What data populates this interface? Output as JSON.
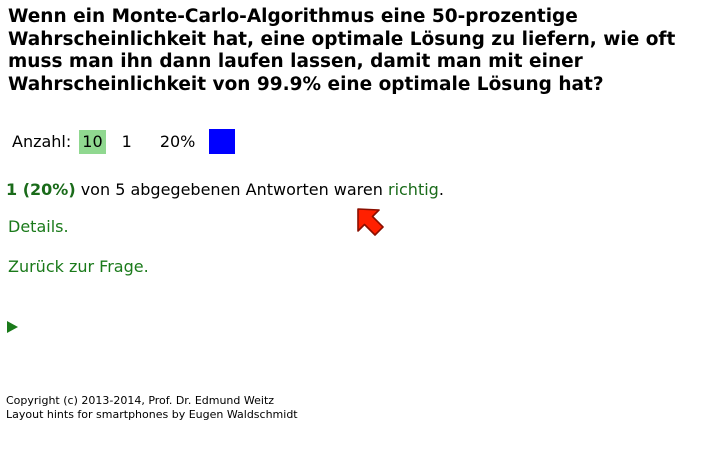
{
  "question": {
    "text": "Wenn ein Monte-Carlo-Algorithmus eine 50-prozentige Wahrscheinlichkeit hat, eine optimale Lösung zu liefern, wie oft muss man ihn dann laufen lassen, damit man mit einer Wahrscheinlichkeit von 99.9% eine optimale Lösung hat?"
  },
  "answers": [
    {
      "label": "Anzahl:",
      "value": "10",
      "count": "1",
      "percent_text": "20%",
      "percent": 20,
      "bar_color": "#0000ff",
      "highlight_color": "#90d890"
    }
  ],
  "summary": {
    "correct_count": "1 (20%)",
    "middle_text": " von 5 abgegebenen Antworten waren ",
    "correct_word": "richtig",
    "end": "."
  },
  "links": {
    "details": "Details.",
    "back": "Zurück zur Frage."
  },
  "icons": {
    "play": "play-triangle-icon",
    "cursor": "mouse-pointer-arrow-icon",
    "cursor_color": "#ff2000"
  },
  "footer": {
    "copyright": "Copyright (c) 2013-2014, Prof. Dr. Edmund Weitz",
    "layout_hints": "Layout hints for smartphones by Eugen Waldschmidt"
  },
  "colors": {
    "link_green": "#1a7a1a",
    "correct_green": "#1a6b1a"
  }
}
